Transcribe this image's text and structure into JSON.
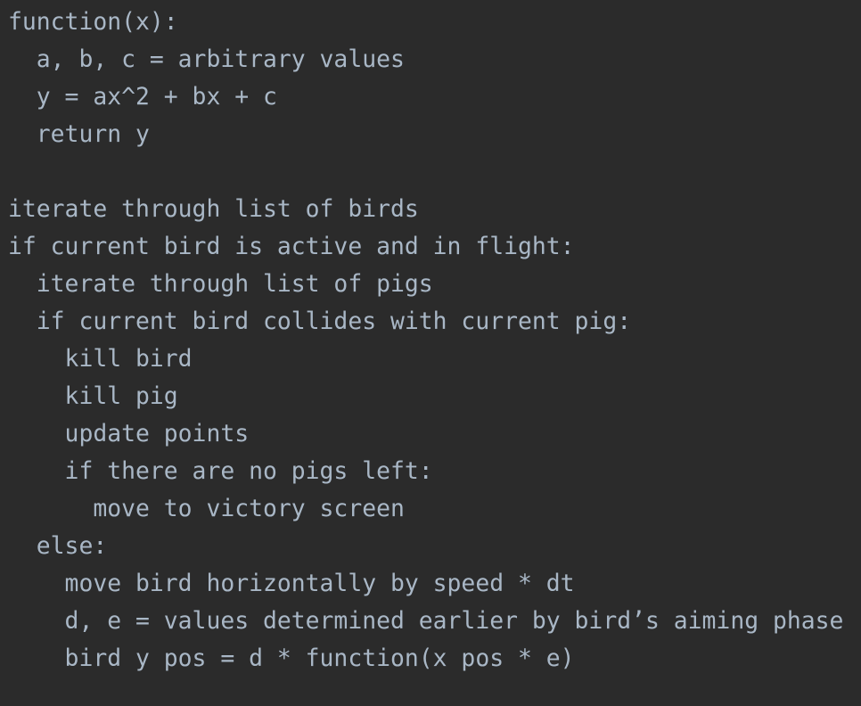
{
  "editor": {
    "lines": [
      "function(x):",
      "  a, b, c = arbitrary values",
      "  y = ax^2 + bx + c",
      "  return y",
      "",
      "iterate through list of birds",
      "if current bird is active and in flight:",
      "  iterate through list of pigs",
      "  if current bird collides with current pig:",
      "    kill bird",
      "    kill pig",
      "    update points",
      "    if there are no pigs left:",
      "      move to victory screen",
      "  else:",
      "    move bird horizontally by speed * dt",
      "    d, e = values determined earlier by bird’s aiming phase",
      "    bird y pos = d * function(x pos * e)"
    ]
  }
}
